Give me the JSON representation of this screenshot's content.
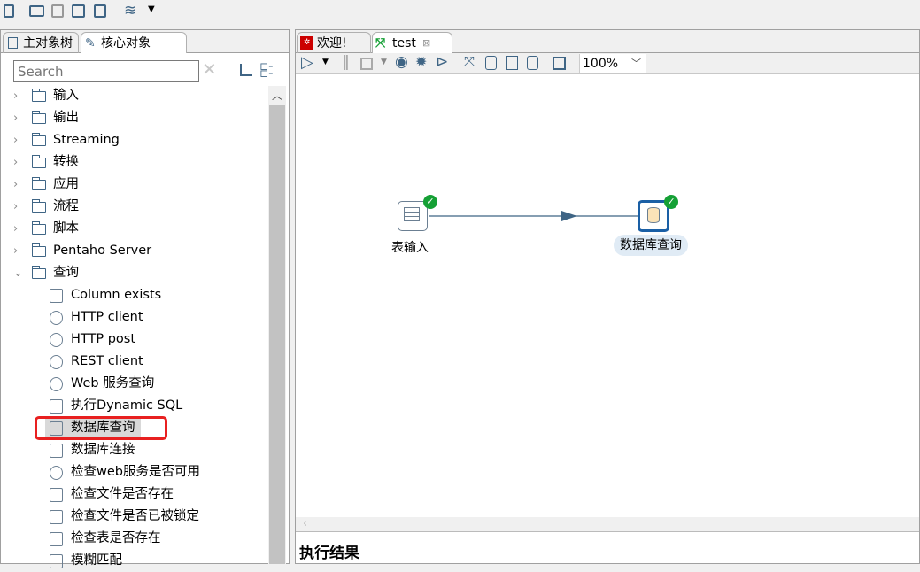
{
  "toolbar": {
    "icons": [
      "new-file-icon",
      "open-folder-icon",
      "explore-repository-icon",
      "save-icon",
      "save-as-icon",
      "layers-icon",
      "dropdown-arrow-icon"
    ]
  },
  "left_panel": {
    "tabs": [
      {
        "label": "主对象树",
        "icon": "search-doc-icon"
      },
      {
        "label": "核心对象",
        "icon": "pencil-icon",
        "active": true
      }
    ],
    "search": {
      "placeholder": "Search",
      "value": ""
    },
    "folders": [
      {
        "label": "输入",
        "expanded": false
      },
      {
        "label": "输出",
        "expanded": false
      },
      {
        "label": "Streaming",
        "expanded": false
      },
      {
        "label": "转换",
        "expanded": false
      },
      {
        "label": "应用",
        "expanded": false
      },
      {
        "label": "流程",
        "expanded": false
      },
      {
        "label": "脚本",
        "expanded": false
      },
      {
        "label": "Pentaho Server",
        "expanded": false
      },
      {
        "label": "查询",
        "expanded": true
      }
    ],
    "query_items": [
      {
        "label": "Column exists",
        "icon": "column-exists-icon"
      },
      {
        "label": "HTTP client",
        "icon": "globe-icon"
      },
      {
        "label": "HTTP post",
        "icon": "globe-icon"
      },
      {
        "label": "REST client",
        "icon": "globe-icon"
      },
      {
        "label": "Web 服务查询",
        "icon": "globe-search-icon"
      },
      {
        "label": "执行Dynamic SQL",
        "icon": "dynamic-sql-icon"
      },
      {
        "label": "数据库查询",
        "icon": "database-search-icon",
        "selected": true,
        "highlighted": true
      },
      {
        "label": "数据库连接",
        "icon": "database-join-icon"
      },
      {
        "label": "检查web服务是否可用",
        "icon": "globe-check-icon"
      },
      {
        "label": "检查文件是否存在",
        "icon": "file-check-icon"
      },
      {
        "label": "检查文件是否已被锁定",
        "icon": "file-lock-icon"
      },
      {
        "label": "检查表是否存在",
        "icon": "table-icon"
      },
      {
        "label": "模糊匹配",
        "icon": "fuzzy-match-icon"
      }
    ]
  },
  "editor": {
    "tabs": [
      {
        "label": "欢迎!",
        "icon": "pentaho-icon"
      },
      {
        "label": "test",
        "icon": "transformation-icon",
        "active": true,
        "closable": true
      }
    ],
    "zoom": "100%",
    "toolbar_icons": [
      "run-icon",
      "run-dropdown-icon",
      "pause-icon",
      "stop-icon",
      "stop-dropdown-icon",
      "preview-icon",
      "debug-icon",
      "replay-icon",
      "verify-icon",
      "analyze-impact-icon",
      "get-sql-icon",
      "explore-db-icon",
      "align-icon"
    ],
    "steps": [
      {
        "label": "表输入",
        "icon": "table-input-icon",
        "status": "ok"
      },
      {
        "label": "数据库查询",
        "icon": "database-search-icon",
        "status": "ok",
        "selected": true
      }
    ],
    "results_title": "执行结果"
  },
  "colors": {
    "accent": "#3f6585",
    "ok": "#15a035",
    "highlight": "#e82020",
    "selected_step": "#1a5fa5"
  }
}
